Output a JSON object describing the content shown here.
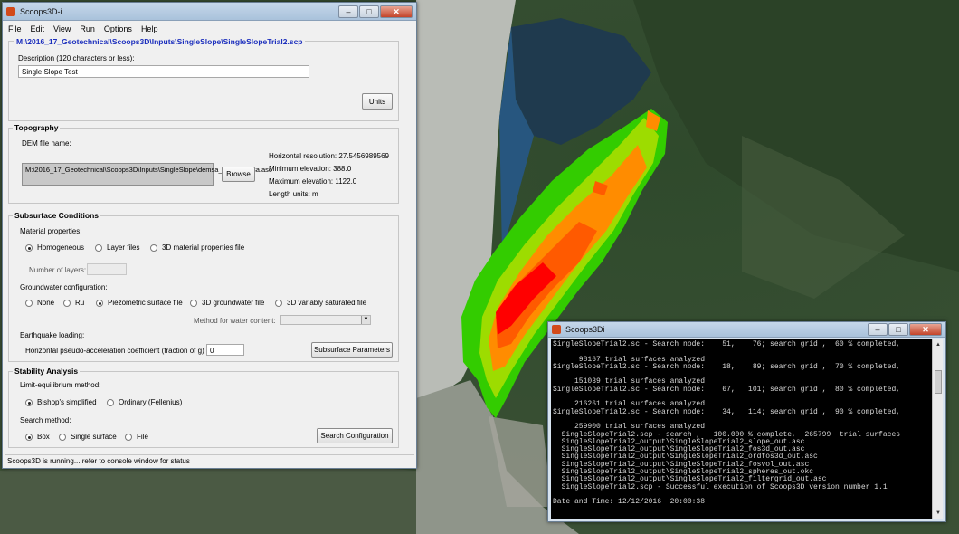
{
  "main_window": {
    "title": "Scoops3D-i",
    "menu": [
      "File",
      "Edit",
      "View",
      "Run",
      "Options",
      "Help"
    ],
    "file_path": "M:\\2016_17_Geotechnical\\Scoops3D\\Inputs\\SingleSlope\\SingleSlopeTrial2.scp",
    "description_label": "Description (120 characters or less):",
    "description_value": "Single Slope Test",
    "units_button": "Units",
    "topography": {
      "title": "Topography",
      "dem_label": "DEM file name:",
      "dem_value": "M:\\2016_17_Geotechnical\\Scoops3D\\Inputs\\SingleSlope\\demsa_singlslopesa.asc",
      "browse_button": "Browse",
      "horizontal_resolution": "Horizontal resolution: 27.5456989569",
      "min_elevation": "Minimum elevation: 388.0",
      "max_elevation": "Maximum elevation: 1122.0",
      "length_units": "Length units: m"
    },
    "subsurface": {
      "title": "Subsurface Conditions",
      "material_label": "Material properties:",
      "material_options": [
        "Homogeneous",
        "Layer files",
        "3D material properties file"
      ],
      "material_selected": 0,
      "layers_label": "Number of layers:",
      "groundwater_label": "Groundwater configuration:",
      "groundwater_options": [
        "None",
        "Ru",
        "Piezometric surface file",
        "3D groundwater file",
        "3D variably saturated file"
      ],
      "groundwater_selected": 2,
      "water_content_label": "Method for water content:",
      "earthquake_label": "Earthquake loading:",
      "pseudo_accel_label": "Horizontal pseudo-acceleration coefficient (fraction of g)",
      "pseudo_accel_value": "0",
      "subsurface_button": "Subsurface Parameters"
    },
    "stability": {
      "title": "Stability Analysis",
      "limit_label": "Limit-equilibrium method:",
      "limit_options": [
        "Bishop's simplified",
        "Ordinary (Fellenius)"
      ],
      "limit_selected": 0,
      "search_label": "Search method:",
      "search_options": [
        "Box",
        "Single surface",
        "File"
      ],
      "search_selected": 0,
      "search_button": "Search Configuration"
    },
    "status": "Scoops3D is running... refer to console window for status"
  },
  "console_window": {
    "title": "Scoops3Di",
    "lines": [
      "SingleSlopeTrial2.sc - Search node:    51,    76; search grid ,  60 % completed,",
      "",
      "      98167 trial surfaces analyzed",
      "SingleSlopeTrial2.sc - Search node:    18,    89; search grid ,  70 % completed,",
      "",
      "     151039 trial surfaces analyzed",
      "SingleSlopeTrial2.sc - Search node:    67,   101; search grid ,  80 % completed,",
      "",
      "     216261 trial surfaces analyzed",
      "SingleSlopeTrial2.sc - Search node:    34,   114; search grid ,  90 % completed,",
      "",
      "     259900 trial surfaces analyzed",
      "  SingleSlopeTrial2.scp - search ,   100.000 % complete,  265799  trial surfaces",
      "  SingleSlopeTrial2_output\\SingleSlopeTrial2_slope_out.asc",
      "  SingleSlopeTrial2_output\\SingleSlopeTrial2_fos3d_out.asc",
      "  SingleSlopeTrial2_output\\SingleSlopeTrial2_ordfos3d_out.asc",
      "  SingleSlopeTrial2_output\\SingleSlopeTrial2_fosvol_out.asc",
      "  SingleSlopeTrial2_output\\SingleSlopeTrial2_spheres_out.okc",
      "  SingleSlopeTrial2_output\\SingleSlopeTrial2_filtergrid_out.asc",
      "  SingleSlopeTrial2.scp - Successful execution of Scoops3D version number 1.1",
      "",
      "Date and Time: 12/12/2016  20:00:38"
    ]
  },
  "colors": {
    "accent_path": "#1c2fbd",
    "fos_low": "#ff0000",
    "fos_mid": "#ff8c00",
    "fos_high": "#33cc00"
  },
  "icons": [
    "app-icon",
    "minimize-icon",
    "maximize-icon",
    "close-icon",
    "dropdown-arrow-icon",
    "scroll-up-icon",
    "scroll-down-icon"
  ]
}
